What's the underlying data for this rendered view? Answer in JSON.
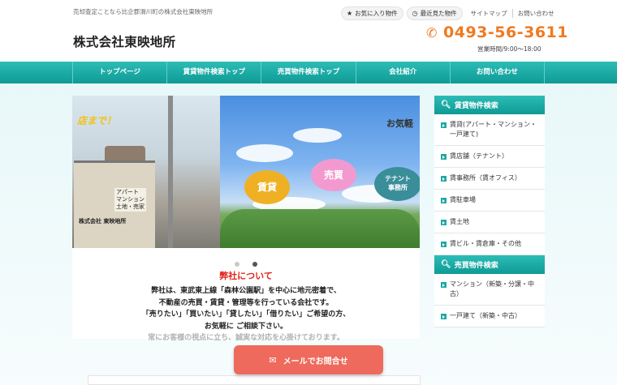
{
  "header": {
    "tagline": "売却査定ことなら比企郡滑川町の株式会社東映地所",
    "logo": "株式会社東映地所",
    "favorites_label": "お気に入り物件",
    "recent_label": "最近見た物件",
    "sitemap_label": "サイトマップ",
    "contact_label": "お問い合わせ",
    "phone": "0493-56-3611",
    "hours": "営業時間/9:00〜18:00"
  },
  "nav": {
    "items": [
      "トップページ",
      "賃貸物件検索トップ",
      "売買物件検索トップ",
      "会社紹介",
      "お問い合わせ"
    ]
  },
  "slider": {
    "banner_text": "店まで！",
    "sign_text": "アパート\nマンション\n土地・売家",
    "company_sign": "株式会社 東映地所",
    "bubble_rent": "賃貸",
    "bubble_sale": "売買",
    "bubble_tenant": "テナント\n事務所",
    "kigaru": "お気軽"
  },
  "about": {
    "title": "弊社について",
    "lines": [
      "弊社は、東武東上線「森林公園駅」を中心に地元密着で、",
      "不動産の売買・賃貸・管理等を行っている会社です。",
      "「売りたい」「買いたい」「貸したい」「借りたい」ご希望の方、",
      "お気軽に ご相談下さい。",
      "常にお客様の視点に立ち、誠実な対応を心掛けております。"
    ]
  },
  "sidebar": {
    "rent_heading": "賃貸物件検索",
    "rent_items": [
      "賃貸(アパート・マンション・一戸建て)",
      "賃店舗（テナント）",
      "賃事務所（賃オフィス）",
      "賃駐車場",
      "賃土地",
      "賃ビル・賃倉庫・その他"
    ],
    "sale_heading": "売買物件検索",
    "sale_items": [
      "マンション（新築・分譲・中古）",
      "一戸建て（新築・中古）"
    ]
  },
  "contact_button": "メールでお問合せ",
  "colors": {
    "accent": "#1ea8a3",
    "phone": "#f07a20",
    "cta": "#ee6a5c",
    "about_title": "#e0241b"
  }
}
